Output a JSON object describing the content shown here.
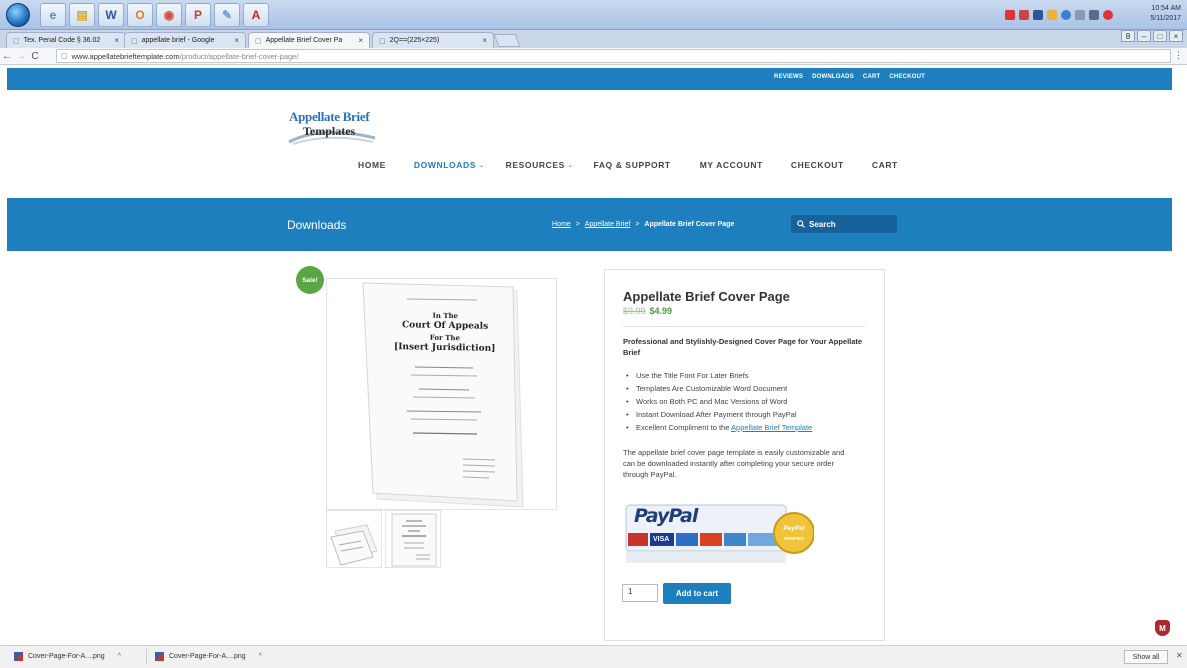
{
  "taskbar": {
    "apps": [
      {
        "name": "ie-icon",
        "glyph": "e",
        "color": "#3a8ee6"
      },
      {
        "name": "folder-icon",
        "glyph": "▤",
        "color": "#d9a82a"
      },
      {
        "name": "word-icon",
        "glyph": "W",
        "color": "#2b5797"
      },
      {
        "name": "outlook-icon",
        "glyph": "O",
        "color": "#e07b1f"
      },
      {
        "name": "chrome-icon",
        "glyph": "◉",
        "color": "#d84a36"
      },
      {
        "name": "powerpoint-icon",
        "glyph": "P",
        "color": "#c5432a"
      },
      {
        "name": "paint-icon",
        "glyph": "✎",
        "color": "#6a9bd8"
      },
      {
        "name": "acrobat-icon",
        "glyph": "A",
        "color": "#c22626"
      }
    ],
    "clock_time": "10:54 AM",
    "clock_date": "5/11/2017"
  },
  "browser": {
    "tabs": [
      {
        "label": "Tex. Penal Code § 36.02",
        "active": false
      },
      {
        "label": "appellate brief - Google",
        "active": false
      },
      {
        "label": "Appellate Brief Cover Pa",
        "active": true
      },
      {
        "label": "2Q==(225×225)",
        "active": false
      }
    ],
    "url_domain": "www.appellatebrieftemplate.com",
    "url_path": "/product/appellate-brief-cover-page/"
  },
  "site": {
    "top_links": [
      "REVIEWS",
      "DOWNLOADS",
      "CART",
      "CHECKOUT"
    ],
    "logo_line1": "Appellate Brief",
    "logo_line2": "Templates",
    "nav": [
      {
        "label": "HOME",
        "caret": false,
        "active": false
      },
      {
        "label": "DOWNLOADS",
        "caret": true,
        "active": true
      },
      {
        "label": "RESOURCES",
        "caret": true,
        "active": false
      },
      {
        "label": "FAQ & SUPPORT",
        "caret": false,
        "active": false
      },
      {
        "label": "MY ACCOUNT",
        "caret": false,
        "active": false
      },
      {
        "label": "CHECKOUT",
        "caret": false,
        "active": false
      },
      {
        "label": "CART",
        "caret": false,
        "active": false
      }
    ],
    "band_title": "Downloads",
    "breadcrumb": {
      "home": "Home",
      "sep": ">",
      "parent": "Appellate Brief",
      "current": "Appellate Brief Cover Page"
    },
    "search_label": "Search"
  },
  "product": {
    "sale_badge": "Sale!",
    "title": "Appellate Brief Cover Page",
    "old_price": "$9.99",
    "new_price": "$4.99",
    "lead": "Professional and Stylishly-Designed Cover Page for Your Appellate Brief",
    "bullets": [
      "Use the Title Font For Later Briefs",
      "Templates Are Customizable Word Document",
      "Works on Both PC and Mac Versions of Word",
      "Instant Download After Payment through PayPal"
    ],
    "last_bullet_prefix": "Excellent Compliment to the ",
    "last_bullet_link": "Appellate Brief Template",
    "description": "The appellate brief cover page template is easily customizable and can be downloaded instantly after completing your secure order through PayPal.",
    "paypal_word": "PayPal",
    "paypal_seal_top": "PayPal",
    "paypal_seal_bottom": "VERIFIED",
    "card_visa": "VISA",
    "quantity": "1",
    "add_to_cart": "Add to cart",
    "doc_lines": [
      "In The",
      "Court Of Appeals",
      "For The",
      "[Insert Jurisdiction]"
    ]
  },
  "downloads": {
    "items": [
      "Cover-Page-For-A....png",
      "Cover-Page-For-A....png"
    ],
    "show_all": "Show all"
  },
  "colors": {
    "brand": "#1e7fbf",
    "sale": "#5aa645",
    "price": "#4f9a3f"
  }
}
